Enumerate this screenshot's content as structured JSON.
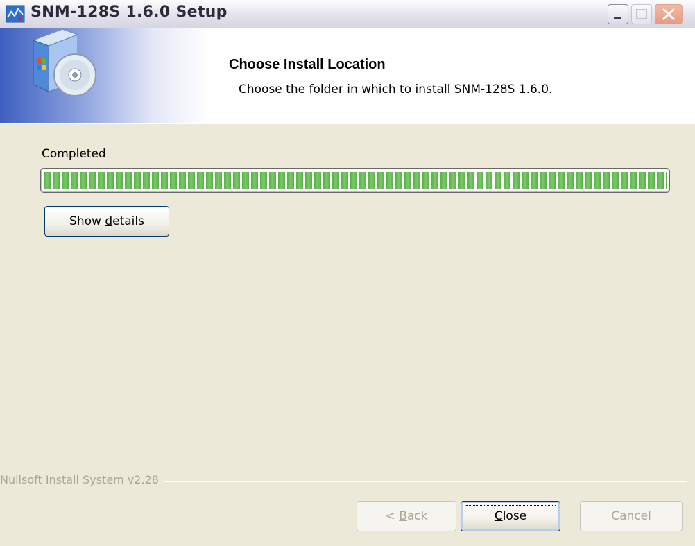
{
  "window": {
    "title": "SNM-128S 1.6.0 Setup"
  },
  "header": {
    "title": "Choose Install Location",
    "subtitle": "Choose the folder in which to install SNM-128S 1.6.0."
  },
  "progress": {
    "label": "Completed",
    "fraction": 1.0,
    "fill_color": "#57b044"
  },
  "details_button": {
    "pre": "Show ",
    "accel": "d",
    "post": "etails"
  },
  "footer": {
    "brand": "Nullsoft Install System v2.28"
  },
  "buttons": {
    "back": {
      "pre": "< ",
      "accel": "B",
      "post": "ack",
      "enabled": false
    },
    "close": {
      "pre": "",
      "accel": "C",
      "post": "lose",
      "enabled": true
    },
    "cancel": {
      "label": "Cancel",
      "enabled": false
    }
  },
  "icons": {
    "app": "installer-app-icon",
    "header": "software-box-cd-icon",
    "minimize": "minimize-icon",
    "maximize": "maximize-icon",
    "close": "close-icon"
  }
}
